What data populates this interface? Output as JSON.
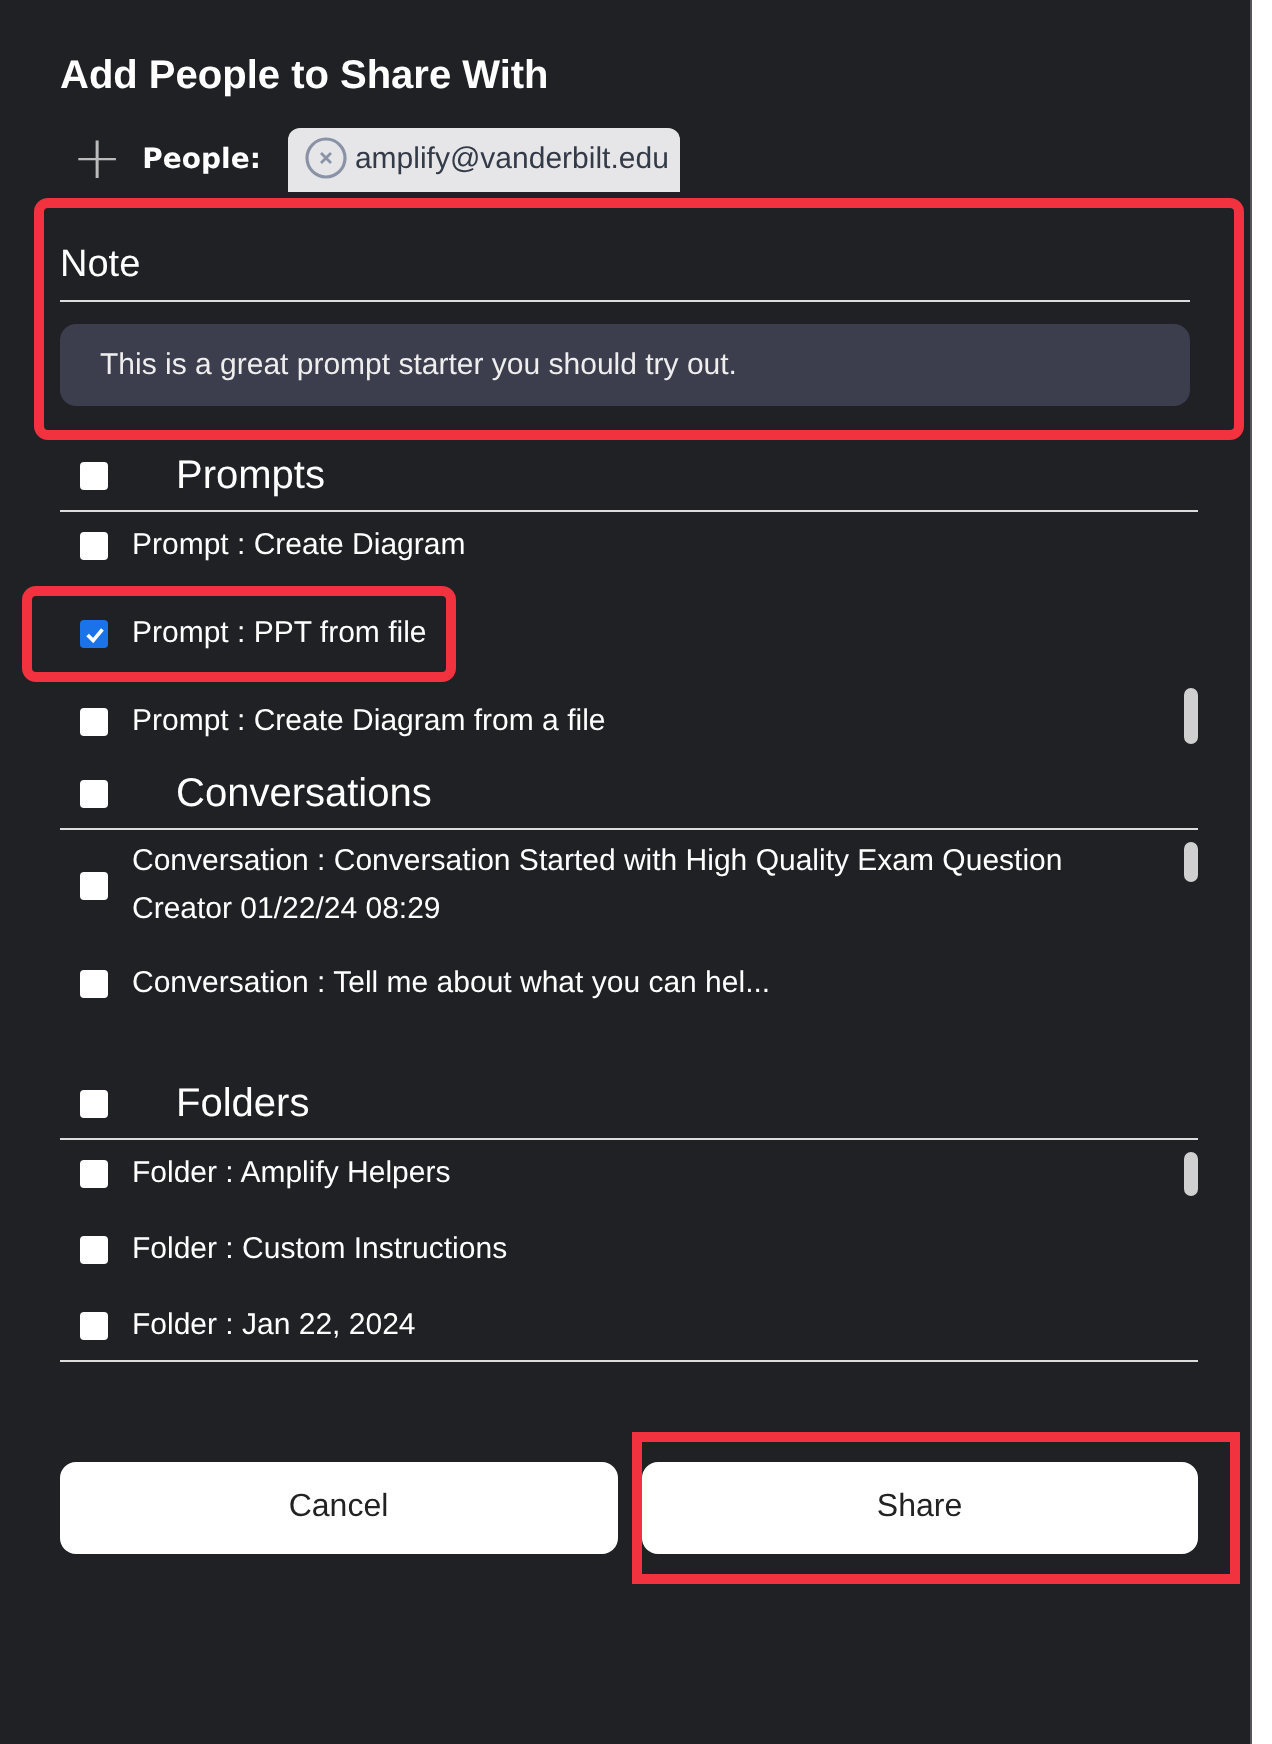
{
  "dialog": {
    "title": "Add People to Share With"
  },
  "people": {
    "add_icon": "+",
    "label": "People:",
    "chips": [
      {
        "email": "amplify@vanderbilt.edu"
      }
    ]
  },
  "note": {
    "label": "Note",
    "value": "This is a great prompt starter you should try out.",
    "highlighted": true
  },
  "sections": [
    {
      "title": "Prompts",
      "checked": false,
      "items": [
        {
          "label": "Prompt : Create Diagram",
          "checked": false,
          "highlighted": false
        },
        {
          "label": "Prompt : PPT from file",
          "checked": true,
          "highlighted": true
        },
        {
          "label": "Prompt : Create Diagram from a file",
          "checked": false,
          "highlighted": false
        }
      ]
    },
    {
      "title": "Conversations",
      "checked": false,
      "items": [
        {
          "label": "Conversation : Conversation Started with High Quality Exam Question Creator 01/22/24 08:29",
          "checked": false,
          "highlighted": false
        },
        {
          "label": "Conversation : Tell me about what you can hel...",
          "checked": false,
          "highlighted": false
        }
      ]
    },
    {
      "title": "Folders",
      "checked": false,
      "items": [
        {
          "label": "Folder : Amplify Helpers",
          "checked": false,
          "highlighted": false
        },
        {
          "label": "Folder : Custom Instructions",
          "checked": false,
          "highlighted": false
        },
        {
          "label": "Folder : Jan 22, 2024",
          "checked": false,
          "highlighted": false
        }
      ]
    }
  ],
  "buttons": [
    {
      "label": "Cancel",
      "highlighted": false
    },
    {
      "label": "Share",
      "highlighted": true
    }
  ]
}
